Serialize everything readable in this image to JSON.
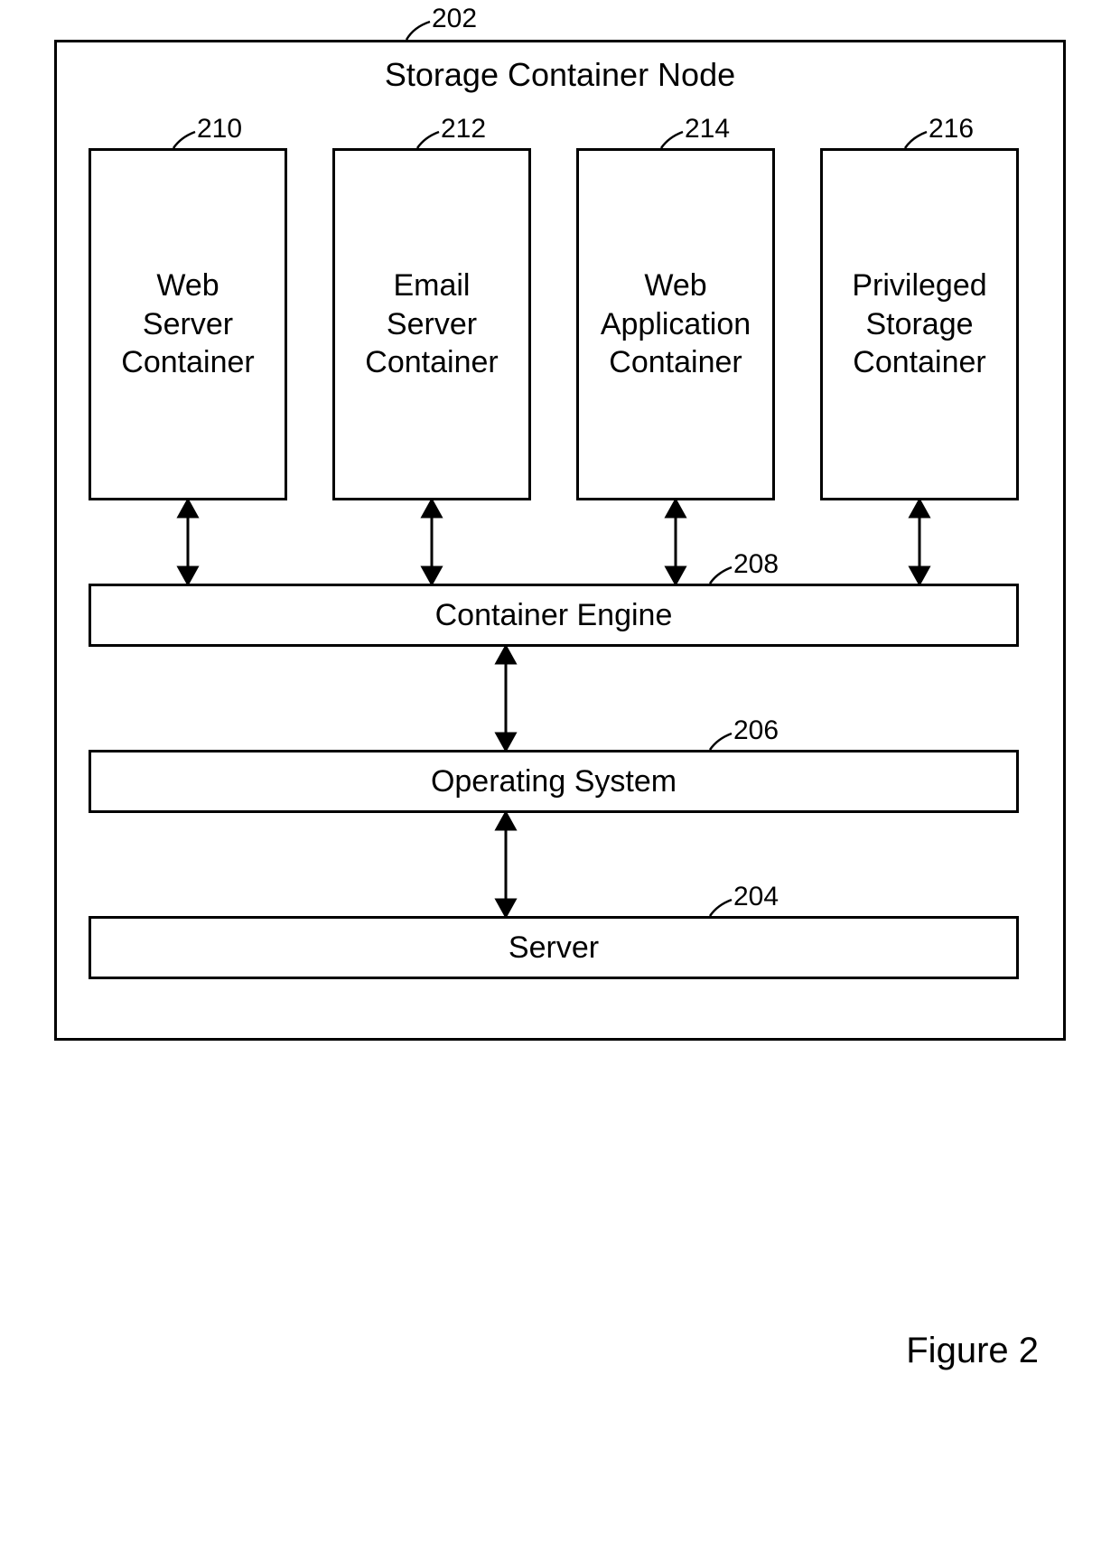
{
  "figure_caption": "Figure 2",
  "outer": {
    "title": "Storage Container Node",
    "ref": "202"
  },
  "containers": [
    {
      "label": "Web\nServer\nContainer",
      "ref": "210"
    },
    {
      "label": "Email\nServer\nContainer",
      "ref": "212"
    },
    {
      "label": "Web\nApplication\nContainer",
      "ref": "214"
    },
    {
      "label": "Privileged\nStorage\nContainer",
      "ref": "216"
    }
  ],
  "layers": [
    {
      "label": "Container Engine",
      "ref": "208"
    },
    {
      "label": "Operating System",
      "ref": "206"
    },
    {
      "label": "Server",
      "ref": "204"
    }
  ]
}
